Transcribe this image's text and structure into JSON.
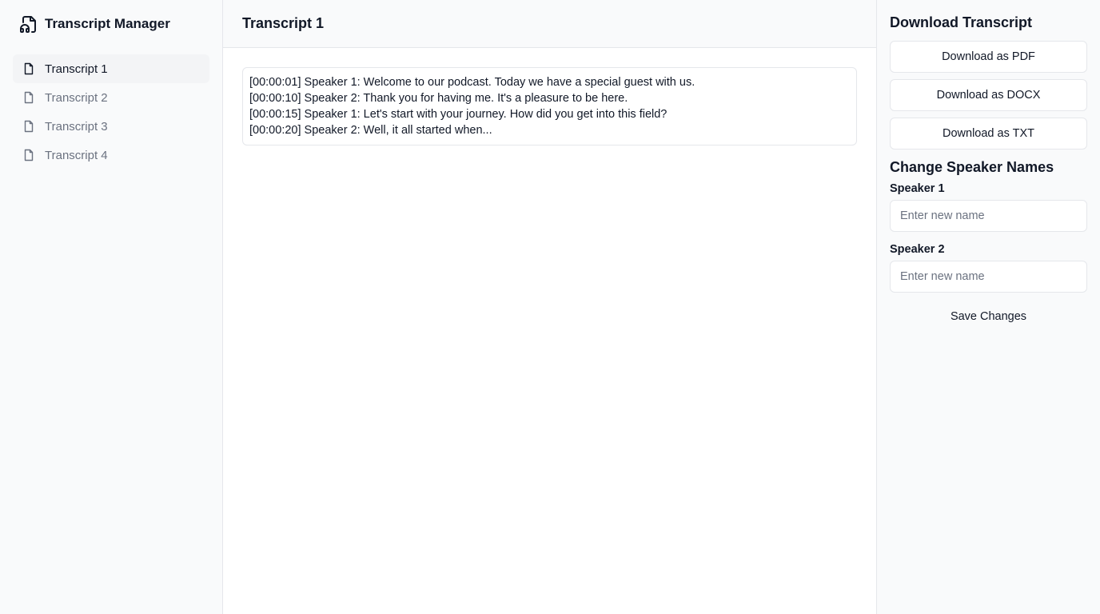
{
  "app": {
    "title": "Transcript Manager",
    "icon": "headphones-file-icon"
  },
  "sidebar": {
    "items": [
      {
        "label": "Transcript 1",
        "icon": "file-icon",
        "active": true
      },
      {
        "label": "Transcript 2",
        "icon": "file-icon",
        "active": false
      },
      {
        "label": "Transcript 3",
        "icon": "file-icon",
        "active": false
      },
      {
        "label": "Transcript 4",
        "icon": "file-icon",
        "active": false
      }
    ]
  },
  "main": {
    "title": "Transcript 1",
    "lines": [
      "[00:00:01] Speaker 1: Welcome to our podcast. Today we have a special guest with us.",
      "[00:00:10] Speaker 2: Thank you for having me. It's a pleasure to be here.",
      "[00:00:15] Speaker 1: Let's start with your journey. How did you get into this field?",
      "[00:00:20] Speaker 2: Well, it all started when..."
    ]
  },
  "download": {
    "title": "Download Transcript",
    "buttons": [
      "Download as PDF",
      "Download as DOCX",
      "Download as TXT"
    ]
  },
  "speakers": {
    "title": "Change Speaker Names",
    "fields": [
      {
        "label": "Speaker 1",
        "placeholder": "Enter new name"
      },
      {
        "label": "Speaker 2",
        "placeholder": "Enter new name"
      }
    ],
    "save_label": "Save Changes"
  },
  "colors": {
    "panel_bg": "#f9fafb",
    "active_bg": "#f3f4f6",
    "border": "#e5e7eb",
    "muted_text": "#6b7280",
    "text": "#111827"
  }
}
